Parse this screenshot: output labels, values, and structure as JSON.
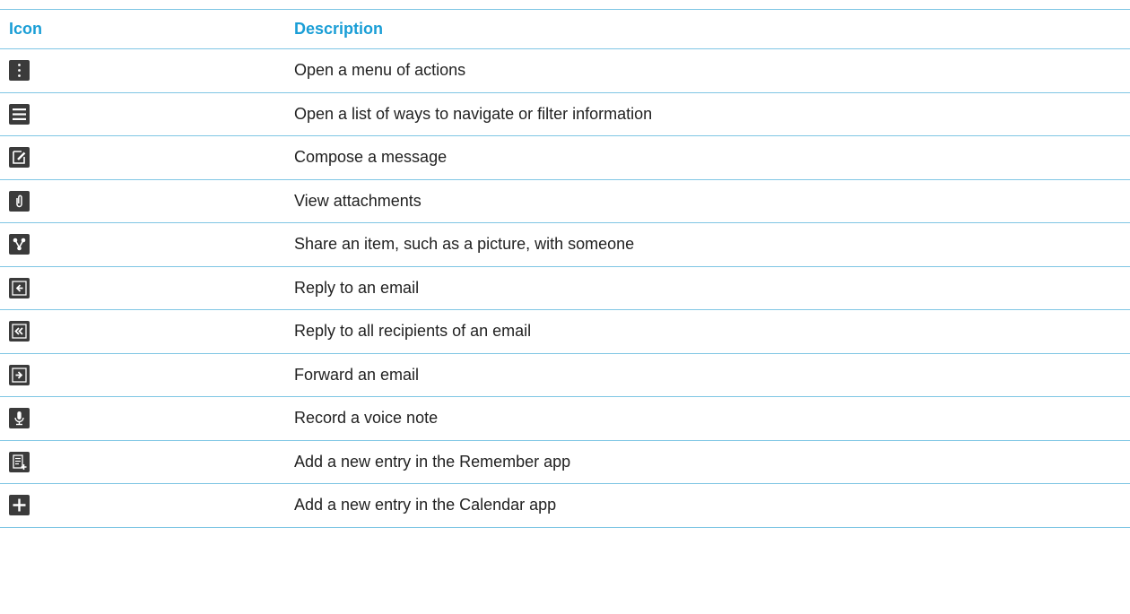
{
  "table": {
    "headers": {
      "icon": "Icon",
      "description": "Description"
    },
    "rows": [
      {
        "icon": "overflow-menu-icon",
        "description": "Open a menu of actions"
      },
      {
        "icon": "hamburger-menu-icon",
        "description": "Open a list of ways to navigate or filter information"
      },
      {
        "icon": "compose-icon",
        "description": "Compose a message"
      },
      {
        "icon": "paperclip-icon",
        "description": "View attachments"
      },
      {
        "icon": "share-icon",
        "description": "Share an item, such as a picture, with someone"
      },
      {
        "icon": "reply-icon",
        "description": "Reply to an email"
      },
      {
        "icon": "reply-all-icon",
        "description": "Reply to all recipients of an email"
      },
      {
        "icon": "forward-icon",
        "description": "Forward an email"
      },
      {
        "icon": "microphone-icon",
        "description": "Record a voice note"
      },
      {
        "icon": "remember-add-icon",
        "description": "Add a new entry in the Remember app"
      },
      {
        "icon": "plus-icon",
        "description": "Add a new entry in the Calendar app"
      }
    ]
  },
  "colors": {
    "accent": "#1a9ed6",
    "rule": "#7fc6e4",
    "icon_bg": "#3b3b3b"
  }
}
